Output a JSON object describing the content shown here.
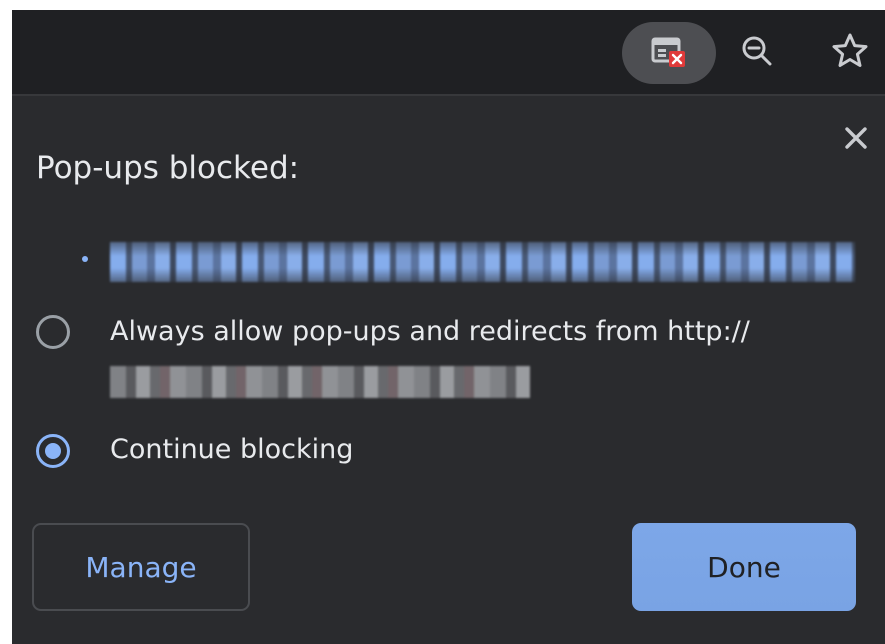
{
  "toolbar": {
    "icons": [
      "popup-blocked-icon",
      "zoom-out-icon",
      "bookmark-star-icon"
    ],
    "colors": {
      "background": "#1f2023",
      "active_pill": "#4d4e52",
      "badge_red": "#e03a3a"
    }
  },
  "bubble": {
    "title": "Pop-ups blocked:",
    "blocked_item_text": "",
    "options": [
      {
        "label": "Always allow pop-ups and redirects from http://",
        "domain_text": "",
        "checked": false
      },
      {
        "label": "Continue blocking",
        "checked": true
      }
    ],
    "buttons": {
      "manage": "Manage",
      "done": "Done"
    },
    "close_icon": "×",
    "colors": {
      "background": "#2a2b2e",
      "text": "#e8eaed",
      "accent": "#8ab4f8",
      "border": "#4a4c50"
    }
  }
}
